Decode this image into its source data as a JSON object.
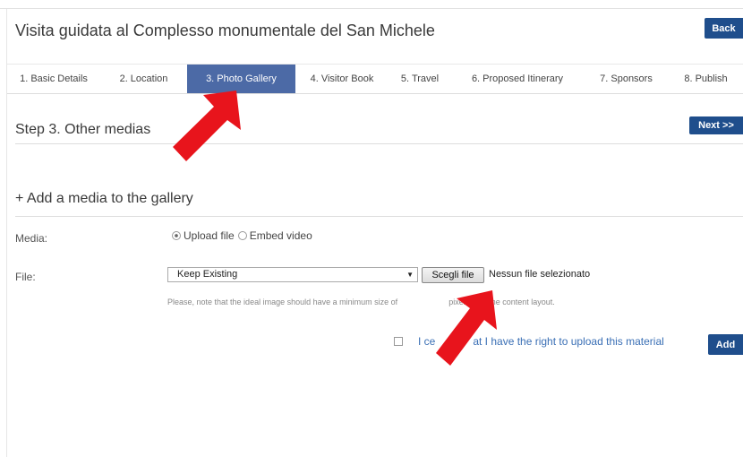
{
  "header": {
    "title": "Visita guidata al Complesso monumentale del San Michele",
    "back_label": "Back"
  },
  "tabs": [
    {
      "label": "1. Basic Details",
      "active": false
    },
    {
      "label": "2. Location",
      "active": false
    },
    {
      "label": "3. Photo Gallery",
      "active": true
    },
    {
      "label": "4. Visitor Book",
      "active": false
    },
    {
      "label": "5. Travel",
      "active": false
    },
    {
      "label": "6. Proposed Itinerary",
      "active": false
    },
    {
      "label": "7. Sponsors",
      "active": false
    },
    {
      "label": "8. Publish",
      "active": false
    }
  ],
  "step": {
    "title": "Step 3. Other medias",
    "next_label": "Next >>"
  },
  "add_media": {
    "heading": "+ Add a media to the gallery",
    "media_label": "Media:",
    "media_options": [
      {
        "label": "Upload file",
        "selected": true
      },
      {
        "label": "Embed video",
        "selected": false
      }
    ],
    "file_label": "File:",
    "select_value": "Keep Existing",
    "choose_file_label": "Scegli file",
    "no_file_text": "Nessun file selezionato",
    "note": "Please, note that the ideal image should have a minimum size of",
    "note_end": "pixels to fit the content layout.",
    "certify_start": "I ce",
    "certify_end": "at I have the right to upload this material",
    "certify_checked": false,
    "add_label": "Add"
  },
  "colors": {
    "accent": "#1f4e8c",
    "active_tab": "#4c6aa6",
    "annotation_arrow": "#e8141c",
    "link": "#3a6fb5"
  }
}
